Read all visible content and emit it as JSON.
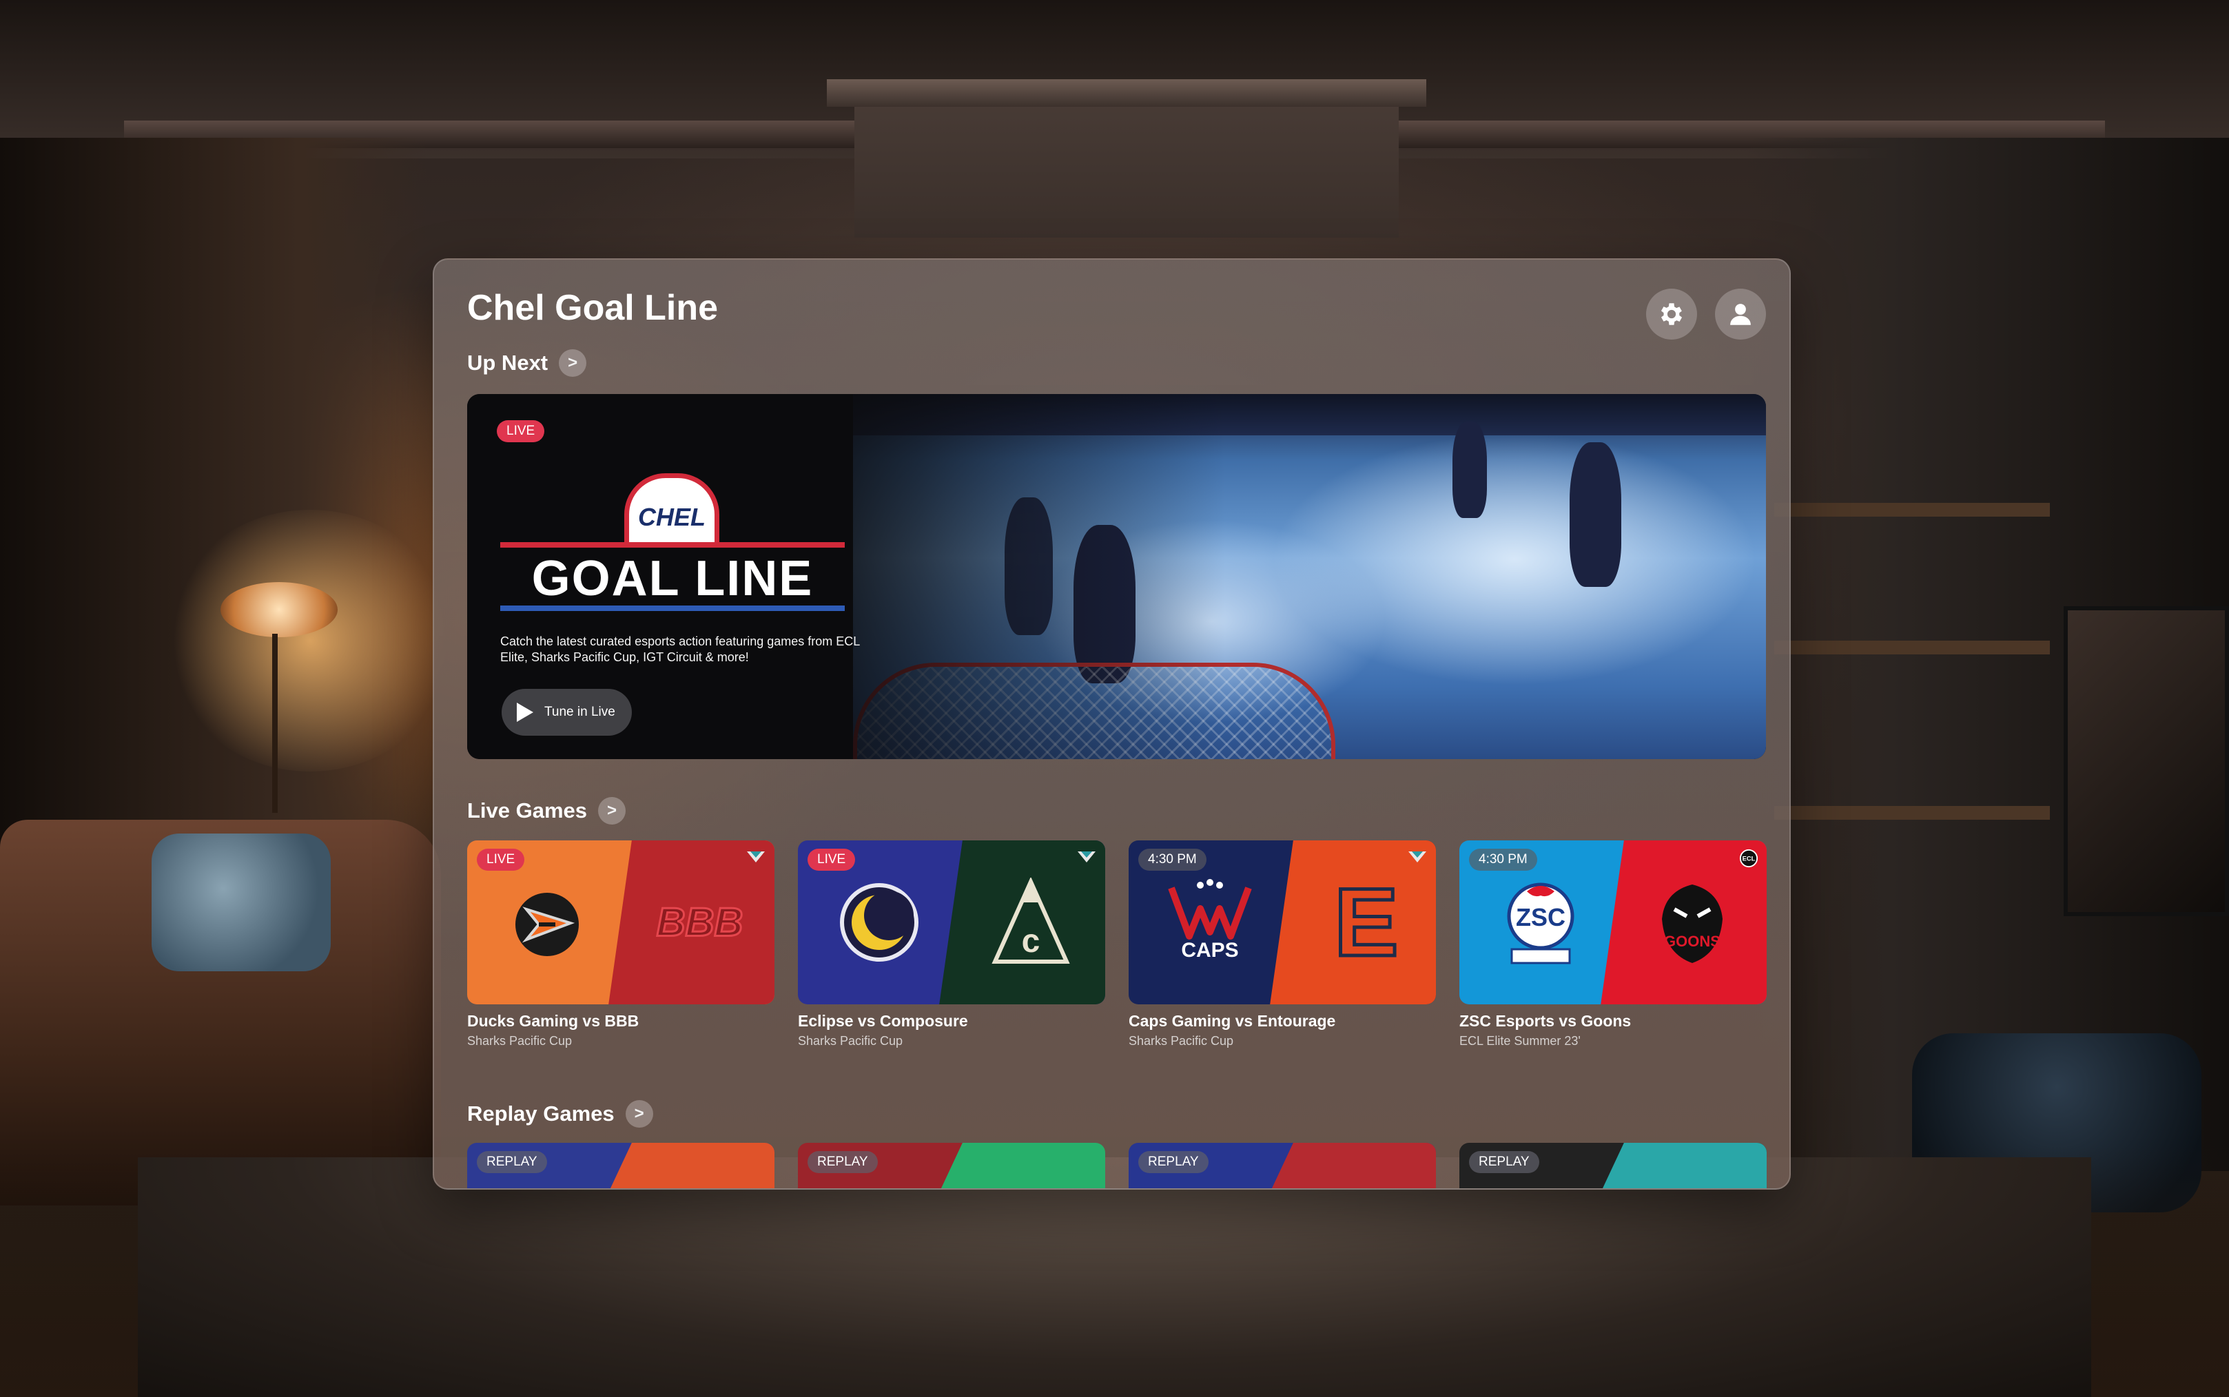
{
  "app": {
    "title": "Chel Goal Line"
  },
  "header": {
    "settings_icon": "gear-icon",
    "profile_icon": "person-icon"
  },
  "up_next": {
    "title": "Up Next",
    "chevron": ">",
    "hero": {
      "badge": "LIVE",
      "logo_top": "CHEL",
      "logo_main": "GOAL LINE",
      "description": "Catch the latest curated esports action featuring games from ECL Elite, Sharks Pacific Cup, IGT Circuit & more!",
      "button_label": "Tune in Live",
      "button_icon": "play-icon"
    }
  },
  "live_games": {
    "title": "Live Games",
    "chevron": ">",
    "cards": [
      {
        "badge": "LIVE",
        "title": "Ducks Gaming vs BBB",
        "subtitle": "Sharks Pacific Cup",
        "home_color": "#ee7a33",
        "away_color": "#b8262b",
        "home_mark": "duck-logo",
        "away_mark": "BBB",
        "league_icon": "sharks-cup-icon"
      },
      {
        "badge": "LIVE",
        "title": "Eclipse vs Composure",
        "subtitle": "Sharks Pacific Cup",
        "home_color": "#2b3192",
        "away_color": "#123322",
        "home_mark": "moon-logo",
        "away_mark": "mountain-logo",
        "league_icon": "sharks-cup-icon"
      },
      {
        "badge": "4:30 PM",
        "title": "Caps Gaming vs Entourage",
        "subtitle": "Sharks Pacific Cup",
        "home_color": "#17245a",
        "away_color": "#e64a1f",
        "home_mark": "CAPS",
        "away_mark": "E",
        "league_icon": "sharks-cup-icon"
      },
      {
        "badge": "4:30 PM",
        "title": "ZSC Esports vs Goons",
        "subtitle": "ECL Elite Summer 23'",
        "home_color": "#1397d8",
        "away_color": "#e0182a",
        "home_mark": "ZSC",
        "away_mark": "GOONS",
        "league_icon": "ecl-icon"
      }
    ]
  },
  "replay_games": {
    "title": "Replay Games",
    "chevron": ">",
    "cards": [
      {
        "badge": "REPLAY",
        "home_color": "#2d3a93",
        "away_color": "#e0532a"
      },
      {
        "badge": "REPLAY",
        "home_color": "#9b242b",
        "away_color": "#27b06b"
      },
      {
        "badge": "REPLAY",
        "home_color": "#273691",
        "away_color": "#b52a30"
      },
      {
        "badge": "REPLAY",
        "home_color": "#222222",
        "away_color": "#2aa7a8"
      }
    ]
  }
}
